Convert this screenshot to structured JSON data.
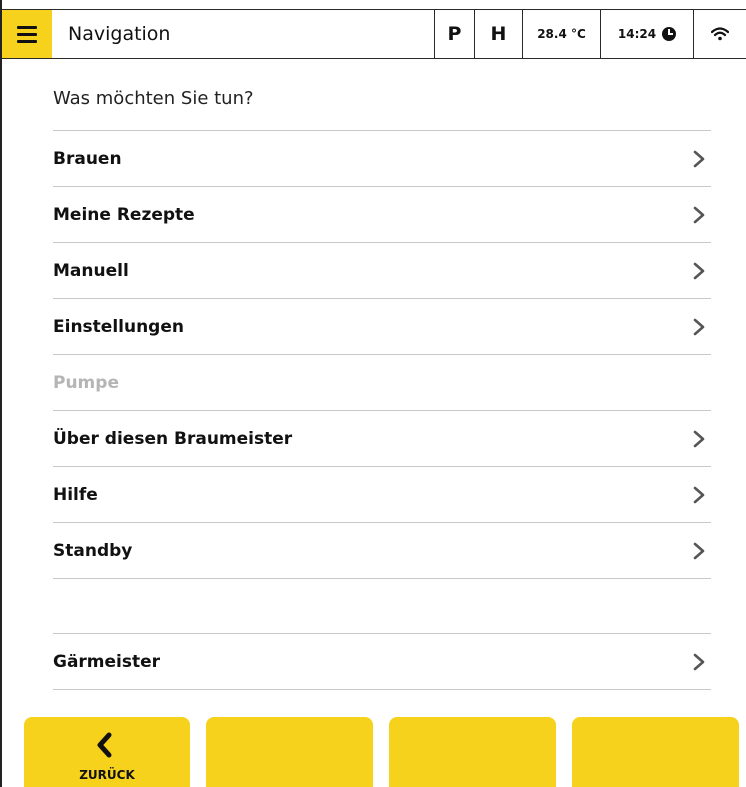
{
  "header": {
    "title": "Navigation",
    "p_label": "P",
    "h_label": "H",
    "temperature": "28.4 °C",
    "time": "14:24"
  },
  "prompt": "Was möchten Sie tun?",
  "menu": [
    {
      "label": "Brauen",
      "enabled": true
    },
    {
      "label": "Meine Rezepte",
      "enabled": true
    },
    {
      "label": "Manuell",
      "enabled": true
    },
    {
      "label": "Einstellungen",
      "enabled": true
    },
    {
      "label": "Pumpe",
      "enabled": false
    },
    {
      "label": "Über diesen Braumeister",
      "enabled": true
    },
    {
      "label": "Hilfe",
      "enabled": true
    },
    {
      "label": "Standby",
      "enabled": true
    },
    {
      "label": "Gärmeister",
      "enabled": true
    }
  ],
  "footer": {
    "back_label": "ZURÜCK"
  },
  "colors": {
    "accent": "#f7d21c",
    "divider": "#c8c8c8",
    "disabled_text": "#b5b5b5"
  }
}
